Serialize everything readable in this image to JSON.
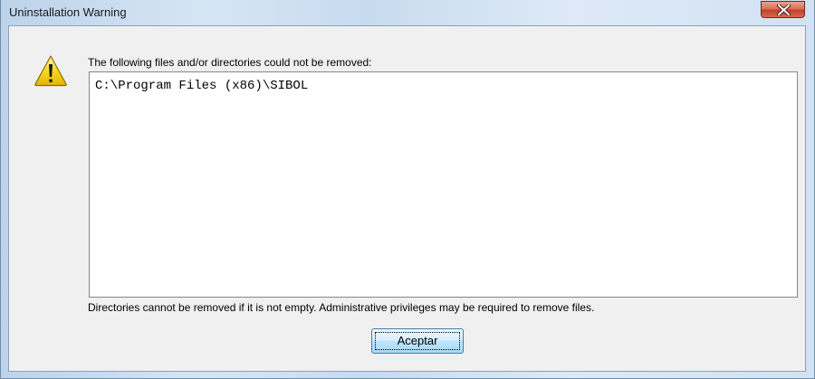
{
  "window": {
    "title": "Uninstallation Warning"
  },
  "icons": {
    "close": "close-icon",
    "warning": "warning-icon"
  },
  "message": {
    "heading": "The following files and/or directories could not be removed:",
    "files": [
      "C:\\Program Files (x86)\\SIBOL"
    ],
    "note": "Directories cannot be removed if it is not empty. Administrative privileges may be required to remove files."
  },
  "buttons": {
    "ok_label": "Aceptar"
  },
  "colors": {
    "close_button": "#c2402a",
    "warning_yellow": "#f5d000"
  }
}
